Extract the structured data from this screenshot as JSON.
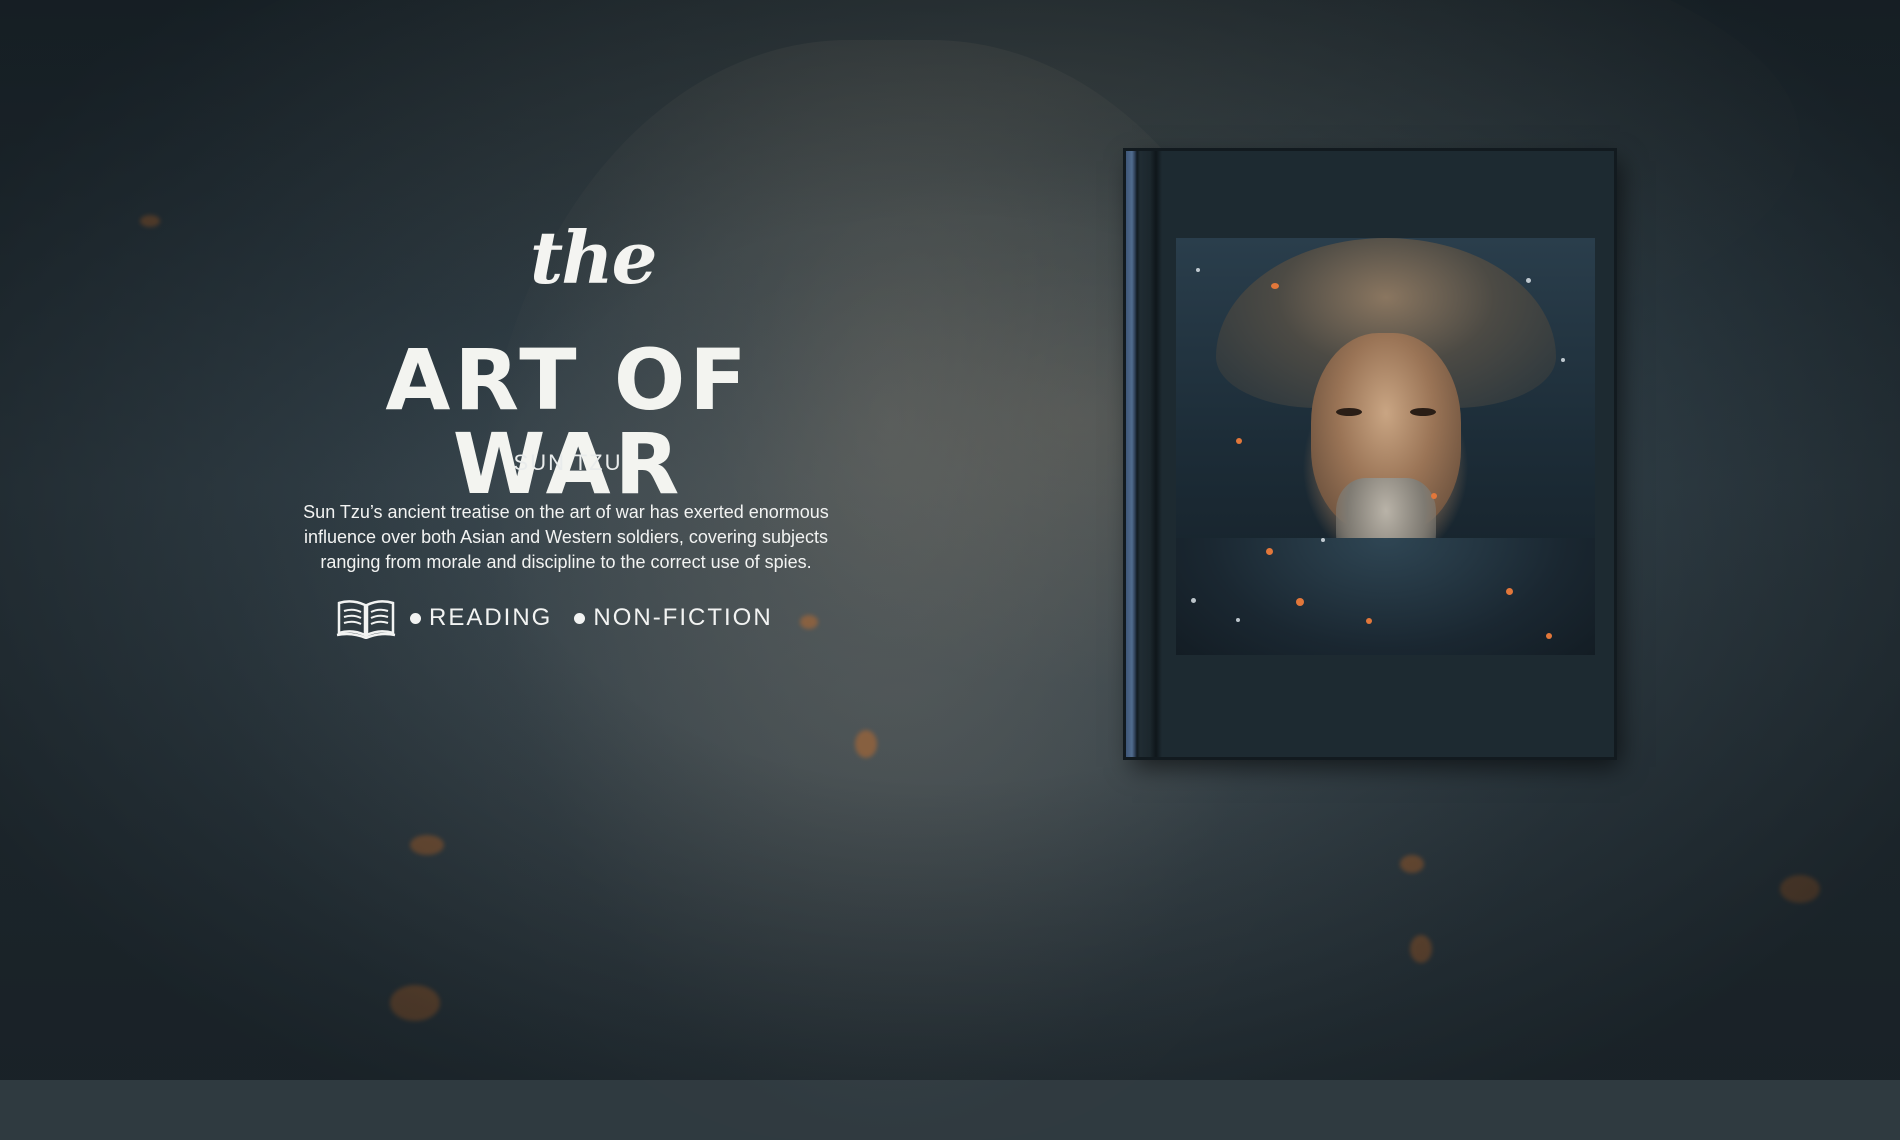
{
  "hero": {
    "script_word": "the",
    "title": "ART OF WAR",
    "author": "SUN TZU",
    "description": "Sun Tzu’s ancient treatise on the art of war has exerted enormous influence over both Asian and Western soldiers, covering subjects ranging from morale and discipline to the correct use of spies.",
    "icon": "open-book-icon",
    "tags": [
      "READING",
      "NON-FICTION"
    ]
  },
  "book": {
    "spine_color": "#4a6488",
    "cover_color": "#1d2a31"
  }
}
